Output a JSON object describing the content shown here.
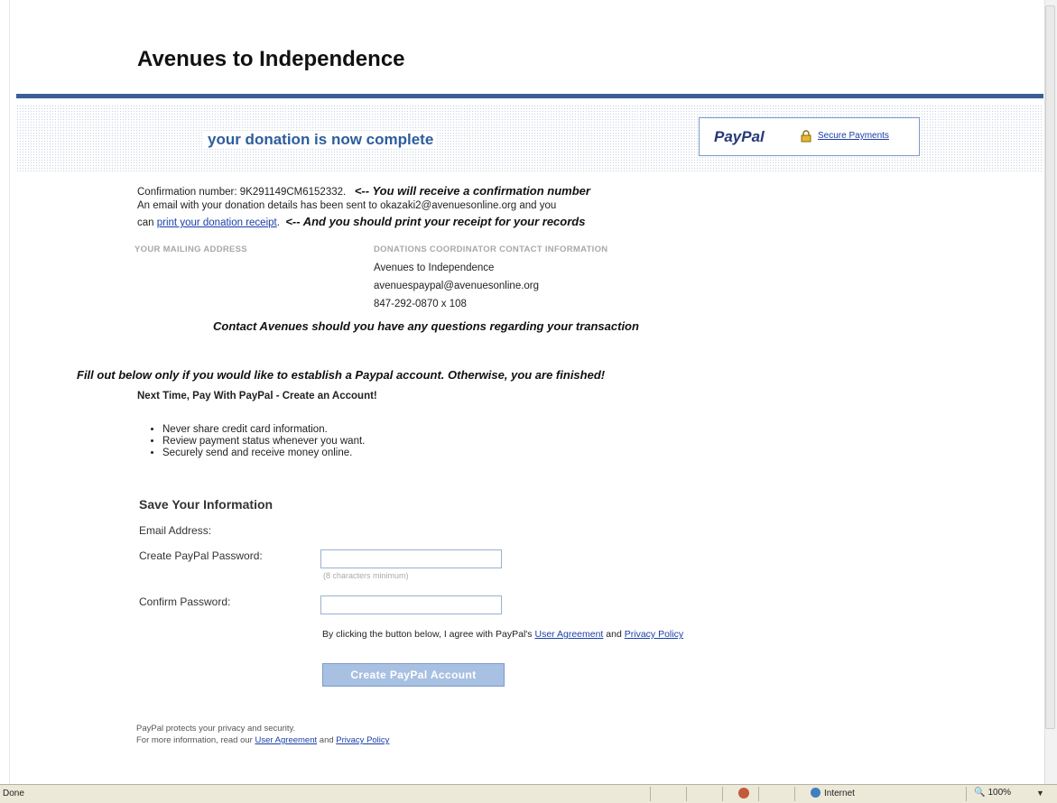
{
  "site": {
    "title": "Avenues to Independence"
  },
  "banner": {
    "complete_message": "your donation is now complete",
    "paypal_logo": "PayPal",
    "secure_payments": "Secure Payments"
  },
  "confirmation": {
    "number_text": "Confirmation number: 9K291149CM6152332.",
    "number_note": "<-- You will receive a confirmation number",
    "email_line": "An email with your donation details has been sent to okazaki2@avenuesonline.org and you",
    "can_text": "can",
    "print_link": "print your donation receipt",
    "period": ".",
    "print_note": "<-- And you should print your receipt for your records"
  },
  "addresses": {
    "mailing_label": "YOUR MAILING ADDRESS",
    "coordinator_label": "DONATIONS COORDINATOR CONTACT INFORMATION",
    "coordinator_name": "Avenues to Independence",
    "coordinator_email": "avenuespaypal@avenuesonline.org",
    "coordinator_phone": "847-292-0870 x 108"
  },
  "contact_note": "Contact Avenues should you have any questions regarding your transaction",
  "fill_note": "Fill out below only if you would like to establish a Paypal account.  Otherwise, you are finished!",
  "next_time": "Next Time, Pay With PayPal - Create an Account!",
  "benefits": [
    "Never share credit card information.",
    "Review payment status whenever you want.",
    "Securely send and receive money online."
  ],
  "form": {
    "title": "Save Your Information",
    "email_label": "Email Address:",
    "password_label": "Create PayPal Password:",
    "password_hint": "(8 characters minimum)",
    "confirm_label": "Confirm Password:",
    "agree_text": "By clicking the button below, I agree with PayPal's",
    "user_agreement": "User Agreement",
    "and": "and",
    "privacy_policy": "Privacy Policy",
    "create_button": "Create PayPal Account"
  },
  "privacy": {
    "line1": "PayPal protects your privacy and security.",
    "line2_prefix": "For more information, read our",
    "user_agreement": "User Agreement",
    "and": "and",
    "privacy_policy": "Privacy Policy"
  },
  "statusbar": {
    "status": "Done",
    "zone": "Internet",
    "zoom": "100%"
  },
  "colors": {
    "rule": "#3a5f97",
    "banner_text": "#2d5d9d",
    "link": "#1a3fa8",
    "button": "#a8c0e2"
  }
}
